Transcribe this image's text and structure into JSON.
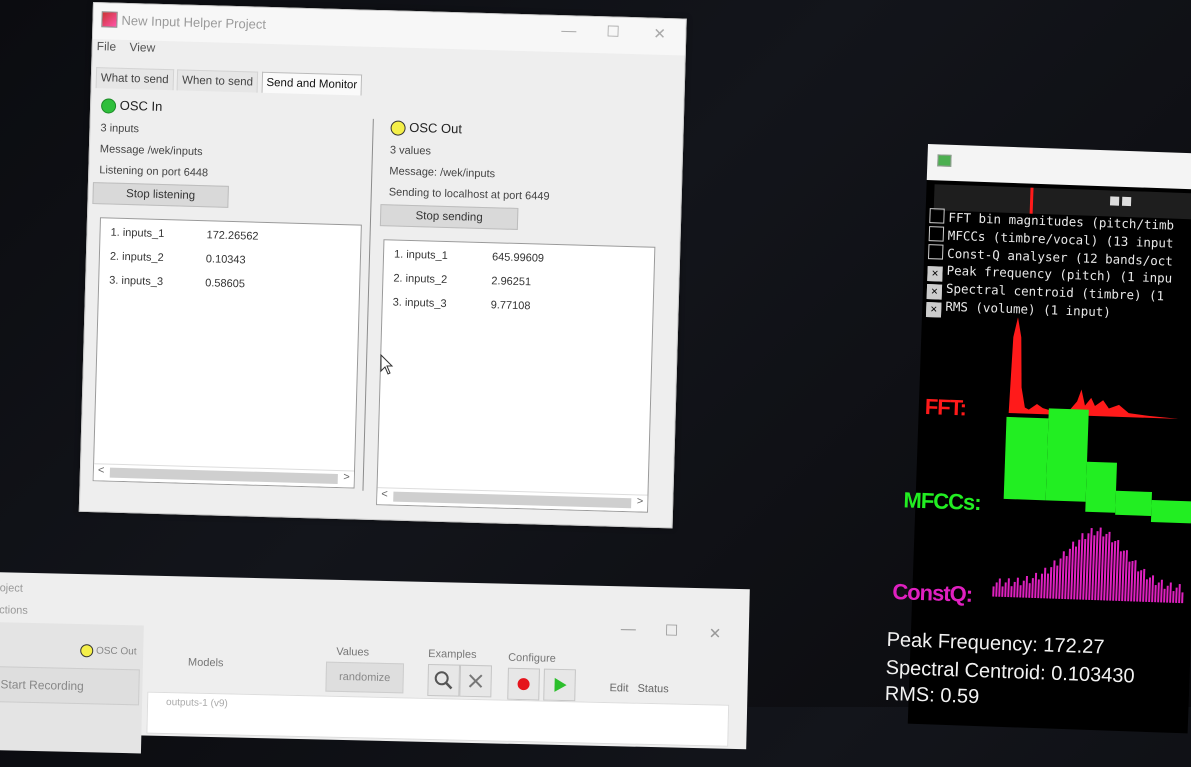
{
  "helper_window": {
    "title": "New Input Helper Project",
    "menu": [
      "File",
      "View"
    ],
    "tabs": [
      "What to send",
      "When to send",
      "Send and Monitor"
    ],
    "active_tab": "Send and Monitor",
    "osc_in": {
      "label": "OSC In",
      "status_color": "#2fbf3c",
      "count": "3 inputs",
      "message": "Message /wek/inputs",
      "listening": "Listening on port 6448",
      "button": "Stop listening",
      "rows": [
        {
          "name": "1. inputs_1",
          "value": "172.26562"
        },
        {
          "name": "2. inputs_2",
          "value": "0.10343"
        },
        {
          "name": "3. inputs_3",
          "value": "0.58605"
        }
      ]
    },
    "osc_out": {
      "label": "OSC Out",
      "status_color": "#f4ef49",
      "count": "3 values",
      "message": "Message: /wek/inputs",
      "sending": "Sending to localhost at port 6449",
      "button": "Stop sending",
      "rows": [
        {
          "name": "1. inputs_1",
          "value": "645.99609"
        },
        {
          "name": "2. inputs_2",
          "value": "2.96251"
        },
        {
          "name": "3. inputs_3",
          "value": "9.77108"
        }
      ]
    }
  },
  "wekinator_window": {
    "title": "oject",
    "menu_fragment": "ctions",
    "osc_out_label": "OSC Out",
    "start_recording": "Start Recording",
    "models_label": "Models",
    "values_label": "Values",
    "randomize": "randomize",
    "examples_label": "Examples",
    "configure_label": "Configure",
    "edit_label": "Edit",
    "status_label": "Status",
    "output_row": "outputs-1 (v9)"
  },
  "feature_window": {
    "options": [
      {
        "label": "FFT bin magnitudes (pitch/timb",
        "checked": false
      },
      {
        "label": "MFCCs (timbre/vocal) (13 input",
        "checked": false
      },
      {
        "label": "Const-Q analyser (12 bands/oct",
        "checked": false
      },
      {
        "label": "Peak frequency (pitch) (1 inpu",
        "checked": true
      },
      {
        "label": "Spectral centroid (timbre) (1",
        "checked": true
      },
      {
        "label": "RMS (volume) (1 input)",
        "checked": true
      }
    ],
    "fft_label": "FFT:",
    "mfcc_label": "MFCCs:",
    "constq_label": "ConstQ:",
    "peak_frequency": "Peak Frequency: 172.27",
    "spectral_centroid": "Spectral Centroid: 0.103430",
    "rms": "RMS: 0.59",
    "colors": {
      "fft": "#ff1a1a",
      "mfcc": "#22ee22",
      "constq": "#e020c0"
    }
  }
}
